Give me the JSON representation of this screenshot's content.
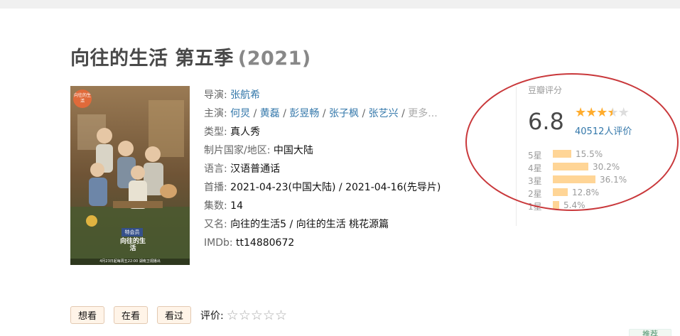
{
  "title": {
    "name": "向往的生活 第五季",
    "year": "(2021)"
  },
  "poster": {
    "badge_top": "向往的生活",
    "badge_mid": "特会员",
    "logo_text": "向往的生活",
    "footer_text": "4月23日起每周五22:00 湖南卫视播出"
  },
  "info": {
    "director_label": "导演:",
    "director": "张航希",
    "cast_label": "主演:",
    "cast": [
      "何炅",
      "黄磊",
      "彭昱畅",
      "张子枫",
      "张艺兴"
    ],
    "cast_sep": " / ",
    "cast_more": "更多...",
    "genre_label": "类型:",
    "genre": "真人秀",
    "country_label": "制片国家/地区:",
    "country": "中国大陆",
    "language_label": "语言:",
    "language": "汉语普通话",
    "premiere_label": "首播:",
    "premiere": "2021-04-23(中国大陆) / 2021-04-16(先导片)",
    "episodes_label": "集数:",
    "episodes": "14",
    "aka_label": "又名:",
    "aka": "向往的生活5 / 向往的生活 桃花源篇",
    "imdb_label": "IMDb:",
    "imdb": "tt14880672"
  },
  "rating": {
    "label": "豆瓣评分",
    "score": "6.8",
    "stars": 3.5,
    "votes": "40512人评价",
    "distribution": [
      {
        "label": "5星",
        "percent": 15.5,
        "text": "15.5%"
      },
      {
        "label": "4星",
        "percent": 30.2,
        "text": "30.2%"
      },
      {
        "label": "3星",
        "percent": 36.1,
        "text": "36.1%"
      },
      {
        "label": "2星",
        "percent": 12.8,
        "text": "12.8%"
      },
      {
        "label": "1星",
        "percent": 5.4,
        "text": "5.4%"
      }
    ]
  },
  "actions": {
    "want": "想看",
    "watching": "在看",
    "watched": "看过",
    "rate_label": "评价:"
  },
  "colors": {
    "link": "#3377aa",
    "star": "#ffac2d",
    "bar": "#ffd596",
    "annotation": "#c9383b",
    "button_bg": "#fff4e8"
  },
  "corner_button": "推荐"
}
